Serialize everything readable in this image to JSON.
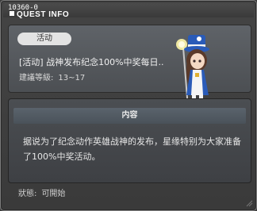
{
  "header": {
    "quest_id": "10360-0",
    "title": "QUEST INFO"
  },
  "quest": {
    "category_badge": "活动",
    "name": "[活动] 战神发布纪念100%中奖每日..",
    "level_label": "建議等級:",
    "level_range": "13~17"
  },
  "content": {
    "section_title": "内容",
    "description": "据说为了纪念动作英雄战神的发布，星缘特别为大家准备了100%中奖活动。"
  },
  "status": {
    "label": "狀態:",
    "value": "可開始"
  },
  "colors": {
    "badge_bg": "#e3e3e3",
    "section_bar": "#535b63",
    "window_bg": "#3f3f3f"
  }
}
